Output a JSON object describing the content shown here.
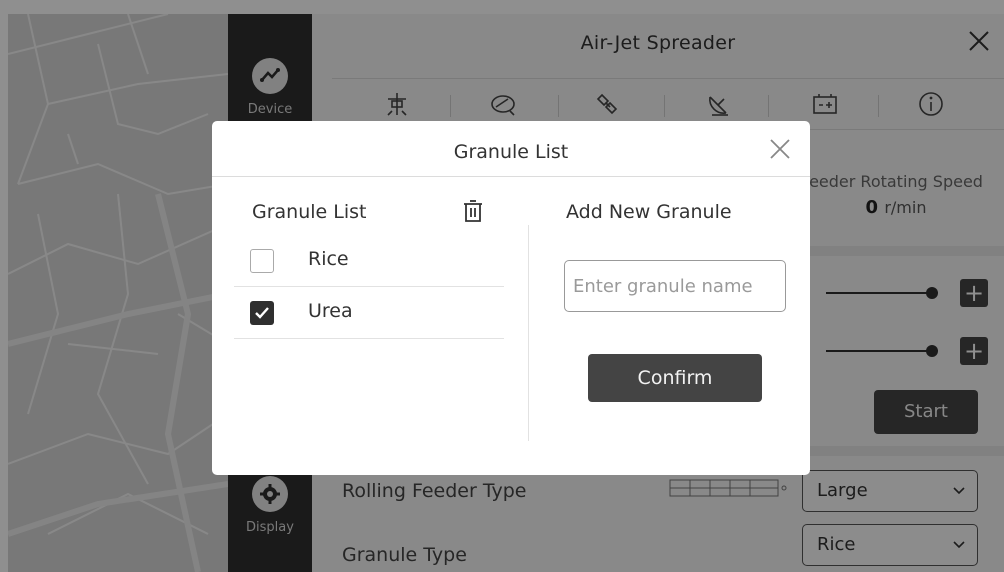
{
  "sidebar": {
    "items": [
      {
        "label": "Device",
        "icon": "device-icon"
      },
      {
        "label": "Display",
        "icon": "gear-icon"
      }
    ]
  },
  "panel": {
    "title": "Air-Jet Spreader",
    "tabs": [
      {
        "icon": "spreader-icon"
      },
      {
        "icon": "feeder-icon"
      },
      {
        "icon": "satellite-icon"
      },
      {
        "icon": "radar-dish-icon"
      },
      {
        "icon": "battery-icon"
      },
      {
        "icon": "info-icon"
      }
    ],
    "metric": {
      "label": "eeder Rotating Speed",
      "value": "0",
      "unit": "r/min"
    },
    "start_label": "Start",
    "params": [
      {
        "label": "Rolling Feeder Type",
        "value": "Large"
      },
      {
        "label": "Granule Type",
        "value": "Rice"
      }
    ],
    "plus_label": "+"
  },
  "modal": {
    "title": "Granule List",
    "list_heading": "Granule List",
    "items": [
      {
        "label": "Rice",
        "checked": false
      },
      {
        "label": "Urea",
        "checked": true
      }
    ],
    "add_heading": "Add New Granule",
    "input_placeholder": "Enter granule name",
    "input_value": "",
    "confirm_label": "Confirm"
  },
  "colors": {
    "dark": "#2f2f2f",
    "button": "#444444",
    "map": "#d6d6d6",
    "overlay": "rgba(0,0,0,0.44)"
  }
}
